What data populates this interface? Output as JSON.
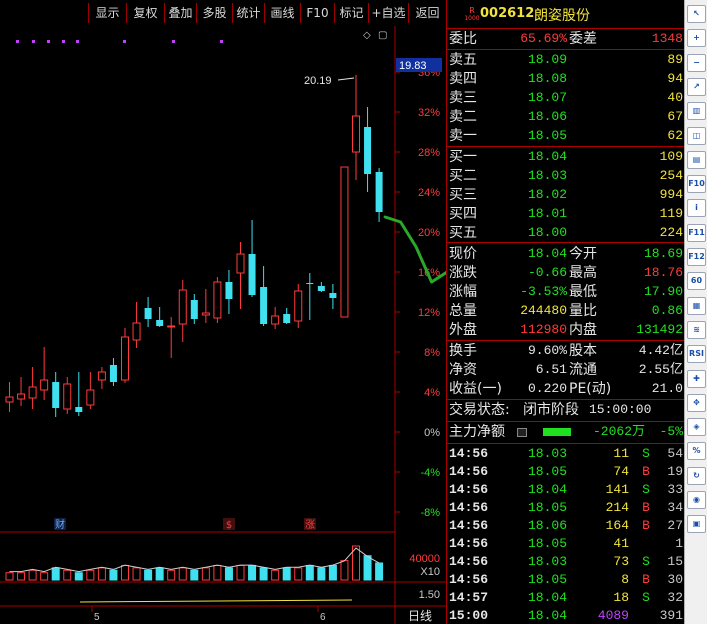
{
  "toolbar": {
    "buttons": [
      "显示",
      "复权",
      "叠加",
      "多股",
      "统计",
      "画线",
      "F10",
      "标记",
      "+自选",
      "返回"
    ]
  },
  "stock": {
    "badge_top": "R",
    "badge_bottom": "1000",
    "code": "002612",
    "name": "朗姿股份"
  },
  "order_book": {
    "ratio_label": "委比",
    "ratio_value": "65.69%",
    "diff_label": "委差",
    "diff_value": "1348",
    "asks": [
      {
        "label": "卖五",
        "price": "18.09",
        "volume": "89"
      },
      {
        "label": "卖四",
        "price": "18.08",
        "volume": "94"
      },
      {
        "label": "卖三",
        "price": "18.07",
        "volume": "40"
      },
      {
        "label": "卖二",
        "price": "18.06",
        "volume": "67"
      },
      {
        "label": "卖一",
        "price": "18.05",
        "volume": "62"
      }
    ],
    "bids": [
      {
        "label": "买一",
        "price": "18.04",
        "volume": "109"
      },
      {
        "label": "买二",
        "price": "18.03",
        "volume": "254"
      },
      {
        "label": "买三",
        "price": "18.02",
        "volume": "994"
      },
      {
        "label": "买四",
        "price": "18.01",
        "volume": "119"
      },
      {
        "label": "买五",
        "price": "18.00",
        "volume": "224"
      }
    ]
  },
  "quote": {
    "rows": [
      {
        "l1": "现价",
        "v1": "18.04",
        "c1": "green",
        "l2": "今开",
        "v2": "18.69",
        "c2": "green"
      },
      {
        "l1": "涨跌",
        "v1": "-0.66",
        "c1": "green",
        "l2": "最高",
        "v2": "18.76",
        "c2": "red"
      },
      {
        "l1": "涨幅",
        "v1": "-3.53%",
        "c1": "green",
        "l2": "最低",
        "v2": "17.90",
        "c2": "green"
      },
      {
        "l1": "总量",
        "v1": "244480",
        "c1": "yellow",
        "l2": "量比",
        "v2": "0.86",
        "c2": "green"
      },
      {
        "l1": "外盘",
        "v1": "112980",
        "c1": "red",
        "l2": "内盘",
        "v2": "131492",
        "c2": "green"
      }
    ],
    "stats": [
      {
        "l1": "换手",
        "v1": "9.60%",
        "l2": "股本",
        "v2": "4.42亿"
      },
      {
        "l1": "净资",
        "v1": "6.51",
        "l2": "流通",
        "v2": "2.55亿"
      },
      {
        "l1": "收益(一)",
        "v1": "0.220",
        "l2": "PE(动)",
        "v2": "21.0"
      }
    ],
    "status_label": "交易状态:",
    "status_value": "闭市阶段",
    "status_time": "15:00:00",
    "netflow_label": "主力净额",
    "netflow_value": "-2062万",
    "netflow_pct": "-5%"
  },
  "trades": [
    {
      "time": "14:56",
      "price": "18.03",
      "vol": "11",
      "side": "S",
      "n": "54"
    },
    {
      "time": "14:56",
      "price": "18.05",
      "vol": "74",
      "side": "B",
      "n": "19"
    },
    {
      "time": "14:56",
      "price": "18.04",
      "vol": "141",
      "side": "S",
      "n": "33"
    },
    {
      "time": "14:56",
      "price": "18.05",
      "vol": "214",
      "side": "B",
      "n": "34"
    },
    {
      "time": "14:56",
      "price": "18.06",
      "vol": "164",
      "side": "B",
      "n": "27"
    },
    {
      "time": "14:56",
      "price": "18.05",
      "vol": "41",
      "side": "",
      "n": "1"
    },
    {
      "time": "14:56",
      "price": "18.03",
      "vol": "73",
      "side": "S",
      "n": "15"
    },
    {
      "time": "14:56",
      "price": "18.05",
      "vol": "8",
      "side": "B",
      "n": "30"
    },
    {
      "time": "14:57",
      "price": "18.04",
      "vol": "18",
      "side": "S",
      "n": "32"
    },
    {
      "time": "15:00",
      "price": "18.04",
      "vol": "4089",
      "side": "",
      "n": "391"
    }
  ],
  "sidebar": {
    "icons": [
      "arrow-icon",
      "zoom-in-icon",
      "zoom-out-icon",
      "trend-icon",
      "bars-icon",
      "kline-icon",
      "book-icon",
      "f10-icon",
      "info-icon",
      "f11-icon",
      "f12-icon",
      "sixty-icon",
      "grid-icon",
      "wave-icon",
      "rsi-icon",
      "cross-icon",
      "move-icon",
      "flow-icon",
      "ratio-icon",
      "refresh-icon",
      "pin-icon",
      "stack-icon"
    ],
    "labels": [
      "↖",
      "+",
      "−",
      "↗",
      "▥",
      "◫",
      "▤",
      "F10",
      "i",
      "F11",
      "F12",
      "60",
      "▦",
      "≋",
      "RSI",
      "✚",
      "✥",
      "◈",
      "%",
      "↻",
      "◉",
      "▣"
    ]
  },
  "chart_data": {
    "type": "candlestick",
    "period_label": "日线",
    "y_axis": {
      "percent_ticks": [
        "36%",
        "32%",
        "28%",
        "24%",
        "20%",
        "16%",
        "12%",
        "8%",
        "4%",
        "0%",
        "-4%",
        "-8%"
      ],
      "percent_values": [
        36,
        32,
        28,
        24,
        20,
        16,
        12,
        8,
        4,
        0,
        -4,
        -8
      ],
      "ylim_percent": [
        -9,
        38
      ],
      "current_price_label": "19.83"
    },
    "annotation": "20.19",
    "candles": [
      {
        "o": 3.0,
        "h": 5.0,
        "l": 2.0,
        "c": 3.5
      },
      {
        "o": 3.3,
        "h": 5.5,
        "l": 2.6,
        "c": 3.8
      },
      {
        "o": 3.4,
        "h": 6.5,
        "l": 2.3,
        "c": 4.5
      },
      {
        "o": 4.2,
        "h": 8.5,
        "l": 3.2,
        "c": 5.2
      },
      {
        "o": 5.0,
        "h": 6.0,
        "l": 1.5,
        "c": 2.4
      },
      {
        "o": 2.3,
        "h": 5.5,
        "l": 1.8,
        "c": 4.8
      },
      {
        "o": 2.5,
        "h": 6.0,
        "l": 1.6,
        "c": 2.0
      },
      {
        "o": 2.7,
        "h": 6.0,
        "l": 2.3,
        "c": 4.2
      },
      {
        "o": 5.2,
        "h": 6.5,
        "l": 4.3,
        "c": 6.0
      },
      {
        "o": 6.7,
        "h": 7.4,
        "l": 4.6,
        "c": 5.0
      },
      {
        "o": 5.2,
        "h": 10.4,
        "l": 4.9,
        "c": 9.5
      },
      {
        "o": 9.2,
        "h": 13.0,
        "l": 8.4,
        "c": 10.9
      },
      {
        "o": 12.4,
        "h": 13.5,
        "l": 10.5,
        "c": 11.3
      },
      {
        "o": 11.2,
        "h": 12.5,
        "l": 10.5,
        "c": 10.6
      },
      {
        "o": 10.5,
        "h": 11.5,
        "l": 7.4,
        "c": 10.6
      },
      {
        "o": 10.8,
        "h": 15.2,
        "l": 9.0,
        "c": 14.2
      },
      {
        "o": 13.2,
        "h": 13.8,
        "l": 10.8,
        "c": 11.3
      },
      {
        "o": 11.7,
        "h": 14.3,
        "l": 10.9,
        "c": 11.9
      },
      {
        "o": 11.4,
        "h": 15.5,
        "l": 10.9,
        "c": 15.0
      },
      {
        "o": 15.0,
        "h": 16.2,
        "l": 11.8,
        "c": 13.3
      },
      {
        "o": 15.9,
        "h": 19.0,
        "l": 12.3,
        "c": 17.8
      },
      {
        "o": 17.8,
        "h": 21.2,
        "l": 13.5,
        "c": 13.7
      },
      {
        "o": 14.5,
        "h": 16.6,
        "l": 10.6,
        "c": 10.8
      },
      {
        "o": 10.8,
        "h": 12.5,
        "l": 10.3,
        "c": 11.6
      },
      {
        "o": 11.8,
        "h": 12.4,
        "l": 10.8,
        "c": 10.9
      },
      {
        "o": 11.1,
        "h": 14.8,
        "l": 10.4,
        "c": 14.1
      },
      {
        "o": 14.9,
        "h": 15.9,
        "l": 11.2,
        "c": 14.8
      },
      {
        "o": 14.6,
        "h": 15.0,
        "l": 14.0,
        "c": 14.1
      },
      {
        "o": 13.9,
        "h": 14.8,
        "l": 12.3,
        "c": 13.4
      },
      {
        "o": 11.5,
        "h": 26.5,
        "l": 11.5,
        "c": 26.5
      },
      {
        "o": 28.0,
        "h": 35.7,
        "l": 25.2,
        "c": 31.6
      },
      {
        "o": 30.5,
        "h": 32.5,
        "l": 24.0,
        "c": 25.8
      },
      {
        "o": 26.0,
        "h": 26.4,
        "l": 21.0,
        "c": 22.0
      }
    ],
    "projection": [
      [
        21.5,
        0
      ],
      [
        21.0,
        1
      ],
      [
        18.5,
        2
      ],
      [
        15.0,
        3
      ],
      [
        16.0,
        4
      ],
      [
        14.0,
        5
      ],
      [
        11.5,
        6
      ],
      [
        12.3,
        7
      ],
      [
        8.0,
        8
      ],
      [
        2.0,
        9
      ]
    ],
    "volume": {
      "ticks": [
        "40000",
        "X10",
        "1.50"
      ],
      "bars": [
        3,
        3,
        4,
        3,
        5,
        4,
        3,
        4,
        5,
        4,
        6,
        5,
        4,
        5,
        4,
        5,
        4,
        5,
        6,
        5,
        6,
        6,
        5,
        4,
        5,
        5,
        6,
        5,
        6,
        8,
        14,
        10,
        7
      ]
    },
    "event_markers": [
      "财",
      "$",
      "涨"
    ],
    "x_ticks": [
      "5",
      "6"
    ]
  }
}
